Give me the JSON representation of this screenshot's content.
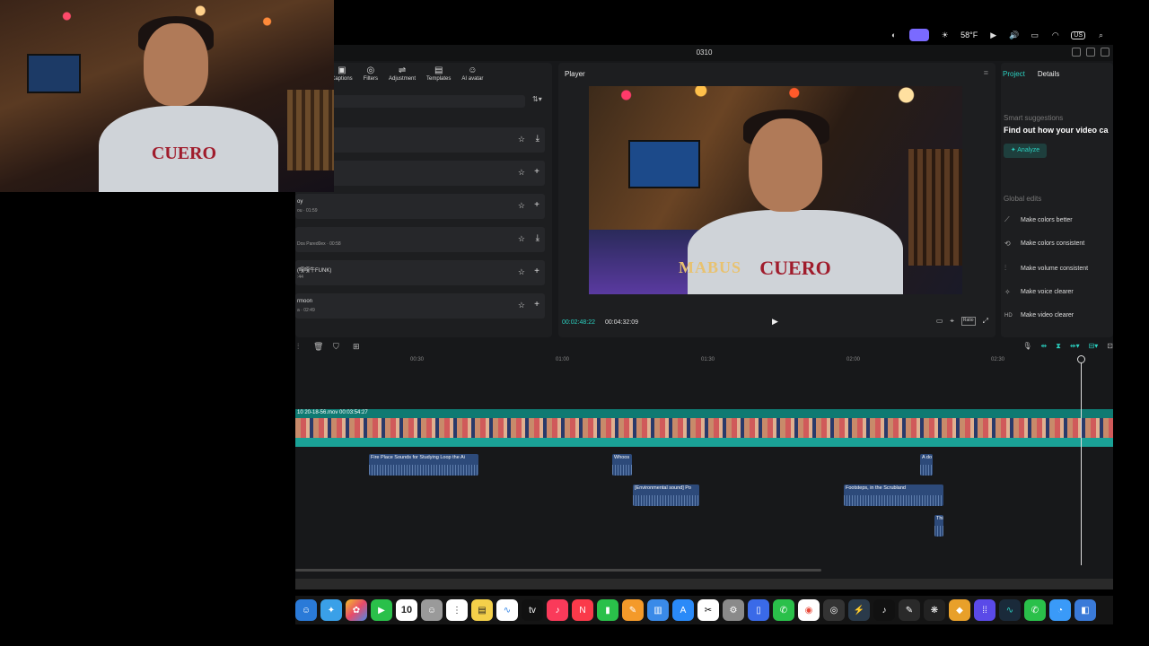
{
  "menubar": {
    "temperature": "58°F",
    "input_source": "US"
  },
  "window": {
    "title": "0310"
  },
  "media_panel": {
    "tabs": [
      {
        "label": "Captions",
        "icon": "captions-icon"
      },
      {
        "label": "Filters",
        "icon": "filters-icon"
      },
      {
        "label": "Adjustment",
        "icon": "adjustment-icon"
      },
      {
        "label": "Templates",
        "icon": "templates-icon"
      },
      {
        "label": "AI avatar",
        "icon": "ai-avatar-icon"
      }
    ],
    "items": [
      {
        "title": "",
        "sub": ""
      },
      {
        "title": "",
        "sub": ""
      },
      {
        "title": "oy",
        "sub": "ou · 01:59"
      },
      {
        "title": "",
        "sub": "Dos Pared0ex · 00:58"
      },
      {
        "title": "(嘎嘎牛FUNK)",
        "sub": ":44"
      },
      {
        "title": "rmoon",
        "sub": "a · 02:49"
      }
    ]
  },
  "player": {
    "label": "Player",
    "caption_overlay": "MABUS",
    "shirt_text": "CUERO",
    "current_time": "00:02:48:22",
    "total_time": "00:04:32:09",
    "ratio_label": "Ratio"
  },
  "details_panel": {
    "tabs": [
      "Project",
      "Details"
    ],
    "smart_suggestions_label": "Smart suggestions",
    "smart_text": "Find out how your video ca",
    "analyze_label": "Analyze",
    "global_edits_label": "Global edits",
    "global_edits": [
      "Make colors better",
      "Make colors consistent",
      "Make volume consistent",
      "Make voice clearer",
      "Make video clearer"
    ]
  },
  "timeline": {
    "ruler": [
      "00:30",
      "01:00",
      "01:30",
      "02:00",
      "02:30"
    ],
    "main_clip_label": "10 20-18-56.mov   00:03:54:27",
    "audio_clips": [
      {
        "label": "Fire Place Sounds for Studying Loop the Ai"
      },
      {
        "label": "Whoos"
      },
      {
        "label": "A do"
      },
      {
        "label": "[Environmental sound] Po"
      },
      {
        "label": "Footsteps, in the Scrubland"
      },
      {
        "label": "Thi"
      }
    ]
  },
  "dock": {
    "calendar_day": "10",
    "icons": [
      "finder-icon",
      "safari-icon",
      "photos-icon",
      "facetime-icon",
      "calendar-icon",
      "contacts-icon",
      "reminders-icon",
      "notes-icon",
      "freeform-icon",
      "tv-icon",
      "music-icon",
      "news-icon",
      "numbers-icon",
      "pages-icon",
      "keynote-icon",
      "app-store-icon",
      "capcut-icon",
      "settings-icon",
      "files-icon",
      "whatsapp-icon",
      "chrome-icon",
      "obs-icon",
      "stream-deck-icon",
      "tiktok-icon",
      "notes-app-icon",
      "chatgpt-icon",
      "game-icon",
      "launchpad-icon",
      "audio-app-icon",
      "phone-icon",
      "messages-icon",
      "other-icon"
    ]
  },
  "colors": {
    "accent": "#2bd1c1",
    "panel": "#1d1e20",
    "main_track": "#0f7a72",
    "audio_clip": "#2d4a7a"
  }
}
